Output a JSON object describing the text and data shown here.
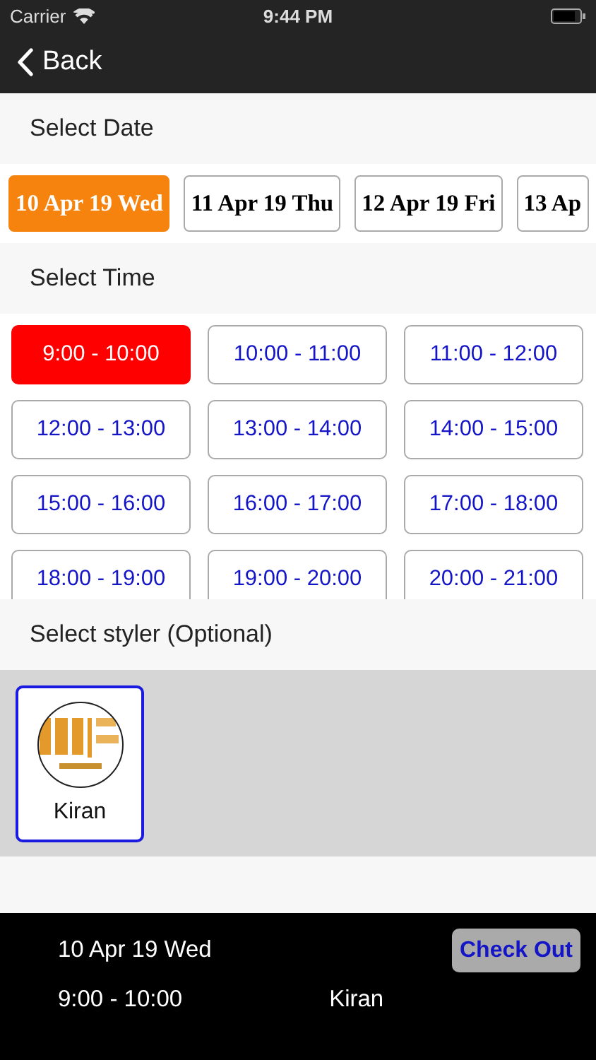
{
  "status_bar": {
    "carrier": "Carrier",
    "time": "9:44 PM"
  },
  "nav": {
    "back": "Back"
  },
  "date_section": {
    "title": "Select Date",
    "dates": [
      {
        "label": "10 Apr 19 Wed",
        "selected": true
      },
      {
        "label": "11 Apr 19 Thu",
        "selected": false
      },
      {
        "label": "12 Apr 19 Fri",
        "selected": false
      },
      {
        "label": "13 Ap",
        "selected": false
      }
    ]
  },
  "time_section": {
    "title": "Select Time",
    "slots": [
      {
        "label": "9:00 - 10:00",
        "selected": true
      },
      {
        "label": "10:00 - 11:00",
        "selected": false
      },
      {
        "label": "11:00 - 12:00",
        "selected": false
      },
      {
        "label": "12:00 - 13:00",
        "selected": false
      },
      {
        "label": "13:00 - 14:00",
        "selected": false
      },
      {
        "label": "14:00 - 15:00",
        "selected": false
      },
      {
        "label": "15:00 - 16:00",
        "selected": false
      },
      {
        "label": "16:00 - 17:00",
        "selected": false
      },
      {
        "label": "17:00 - 18:00",
        "selected": false
      },
      {
        "label": "18:00 - 19:00",
        "selected": false
      },
      {
        "label": "19:00 - 20:00",
        "selected": false
      },
      {
        "label": "20:00 - 21:00",
        "selected": false
      }
    ]
  },
  "styler_section": {
    "title": "Select styler (Optional)",
    "stylers": [
      {
        "name": "Kiran",
        "selected": true,
        "kind": "picture"
      }
    ]
  },
  "summary": {
    "date": "10 Apr 19 Wed",
    "time": "9:00 - 10:00",
    "styler": "Kiran",
    "checkout": "Check Out"
  }
}
